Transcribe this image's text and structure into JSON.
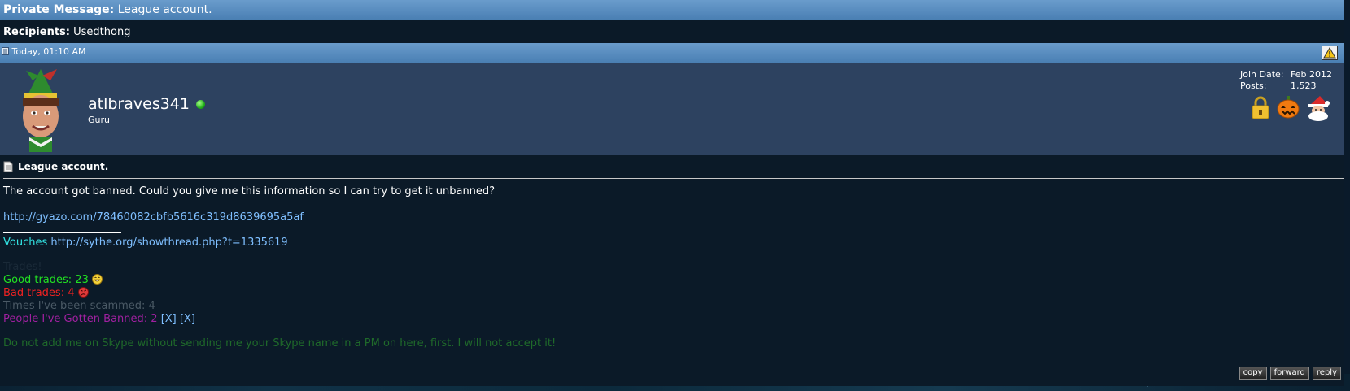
{
  "header": {
    "label": "Private Message",
    "title": "League account."
  },
  "recipients": {
    "label": "Recipients",
    "value": "Usedthong"
  },
  "post": {
    "timestamp": "Today, 01:10 AM",
    "user": {
      "name": "atlbraves341",
      "rank": "Guru",
      "join_label": "Join Date:",
      "join_value": "Feb 2012",
      "posts_label": "Posts:",
      "posts_value": "1,523"
    },
    "message_title": "League account.",
    "body_text": "The account got banned. Could you give me this information so I can try to get it unbanned?",
    "body_link": "http://gyazo.com/78460082cbfb5616c319d8639695a5af",
    "signature": {
      "vouches_label": "Vouches",
      "vouches_link": "http://sythe.org/showthread.php?t=1335619",
      "trades_heading": "Trades!",
      "good_trades": "Good trades: 23",
      "bad_trades": "Bad trades: 4",
      "scammed": "Times I've been scammed: 4",
      "banned": "People I've Gotten Banned: 2",
      "banned_links": [
        "[X]",
        "[X]"
      ],
      "skype_note": "Do not add me on Skype without sending me your Skype name in a PM on here, first. I will not accept it!"
    },
    "buttons": {
      "copy": "copy",
      "forward": "forward",
      "reply": "reply"
    }
  },
  "colors": {
    "header_blue": "#5a8ec2",
    "panel_dark": "#0b1a28",
    "userbar": "#2d4260",
    "good": "#22e022",
    "bad": "#ee2222",
    "banned": "#a020a0",
    "link": "#7fbfff"
  }
}
